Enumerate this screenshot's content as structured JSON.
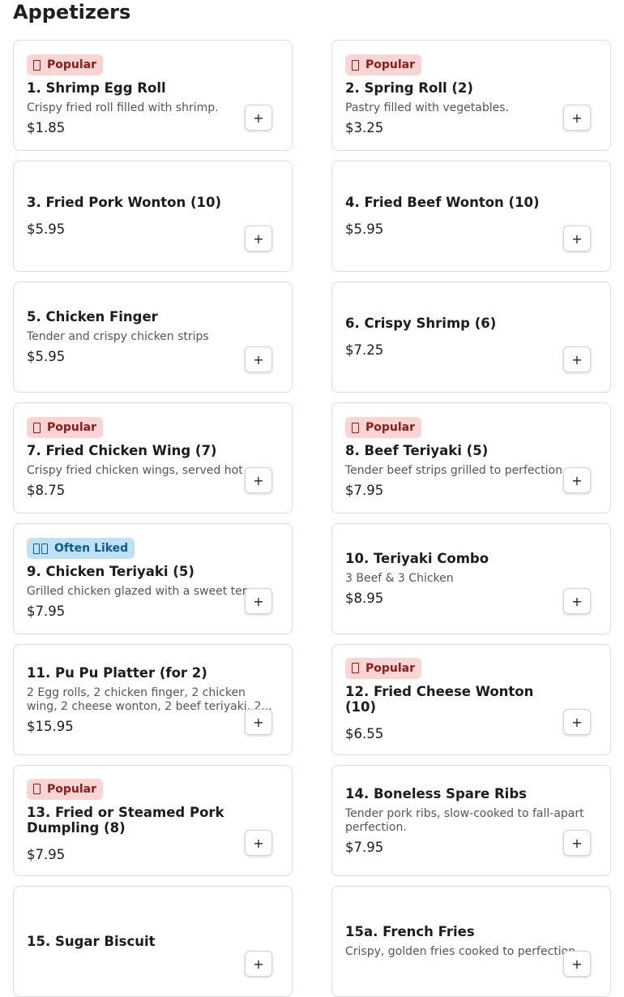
{
  "section": {
    "title": "Appetizers"
  },
  "badges": {
    "popular": "Popular",
    "often_liked": "Often Liked"
  },
  "add_label": "+",
  "colors": {
    "popular_bg": "#fbd5d3",
    "popular_text": "#8a1c1c",
    "liked_bg": "#bfe0f5",
    "liked_text": "#0b5d8e"
  },
  "items": [
    {
      "name": "1. Shrimp Egg Roll",
      "desc": "Crispy fried roll filled with shrimp.",
      "price": "$1.85",
      "badge": "popular"
    },
    {
      "name": "2. Spring Roll (2)",
      "desc": "Pastry filled with vegetables.",
      "price": "$3.25",
      "badge": "popular"
    },
    {
      "name": "3. Fried Pork Wonton (10)",
      "desc": "",
      "price": "$5.95",
      "badge": ""
    },
    {
      "name": "4. Fried Beef Wonton (10)",
      "desc": "",
      "price": "$5.95",
      "badge": ""
    },
    {
      "name": "5. Chicken Finger",
      "desc": "Tender and crispy chicken strips",
      "price": "$5.95",
      "badge": ""
    },
    {
      "name": "6. Crispy Shrimp (6)",
      "desc": "",
      "price": "$7.25",
      "badge": ""
    },
    {
      "name": "7. Fried Chicken Wing (7)",
      "desc": "Crispy fried chicken wings, served hot",
      "price": "$8.75",
      "badge": "popular"
    },
    {
      "name": "8. Beef Teriyaki (5)",
      "desc": "Tender beef strips grilled to perfection",
      "price": "$7.95",
      "badge": "popular"
    },
    {
      "name": "9. Chicken Teriyaki (5)",
      "desc": "Grilled chicken glazed with a sweet ter...",
      "price": "$7.95",
      "badge": "liked"
    },
    {
      "name": "10. Teriyaki Combo",
      "desc": "3 Beef & 3 Chicken",
      "price": "$8.95",
      "badge": ""
    },
    {
      "name": "11. Pu Pu Platter (for 2)",
      "desc": "2 Egg rolls, 2 chicken finger, 2 chicken wing, 2 cheese wonton, 2 beef teriyaki, 2...",
      "price": "$15.95",
      "badge": ""
    },
    {
      "name": "12. Fried Cheese Wonton (10)",
      "desc": "",
      "price": "$6.55",
      "badge": "popular"
    },
    {
      "name": "13. Fried or Steamed Pork Dumpling (8)",
      "desc": "",
      "price": "$7.95",
      "badge": "popular"
    },
    {
      "name": "14. Boneless Spare Ribs",
      "desc": "Tender pork ribs, slow-cooked to fall-apart perfection.",
      "price": "$7.95",
      "badge": ""
    },
    {
      "name": "15. Sugar Biscuit",
      "desc": "",
      "price": "",
      "badge": ""
    },
    {
      "name": "15a. French Fries",
      "desc": "Crispy, golden fries cooked to perfection.",
      "price": "",
      "badge": ""
    }
  ]
}
